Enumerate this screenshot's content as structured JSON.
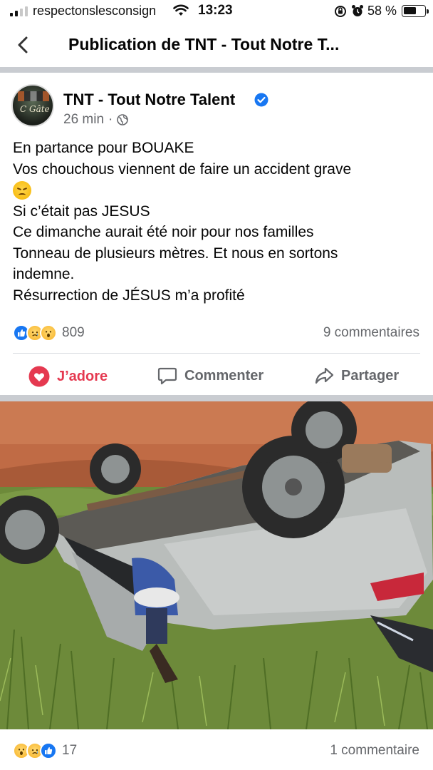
{
  "status_bar": {
    "carrier": "respectonslesconsign",
    "time": "13:23",
    "battery": "58 %"
  },
  "header": {
    "title": "Publication de TNT - Tout Notre T..."
  },
  "post": {
    "author": "TNT - Tout Notre Talent",
    "avatar_text": "C Gâte",
    "time": "26 min",
    "text_lines": [
      "En partance pour BOUAKE",
      "Vos chouchous  viennent de faire un accident grave",
      "Si c’était pas JESUS",
      "Ce dimanche aurait été noir pour nos familles",
      "Tonneau de plusieurs mètres. Et nous en sortons",
      "indemne.",
      "Résurrection de JÉSUS m’a profité"
    ],
    "reaction_count": "809",
    "comments_count": "9 commentaires",
    "reaction_icons": [
      "like-icon",
      "sad-icon",
      "wow-icon"
    ]
  },
  "actions": {
    "love": "J’adore",
    "comment": "Commenter",
    "share": "Partager"
  },
  "next_post": {
    "reaction_count": "17",
    "comments_count": "1 commentaire",
    "reaction_icons": [
      "wow-icon",
      "sad-icon",
      "like-icon"
    ]
  },
  "colors": {
    "love": "#e53950",
    "like": "#1877f2",
    "verified": "#1877f2",
    "muted": "#65676b"
  }
}
